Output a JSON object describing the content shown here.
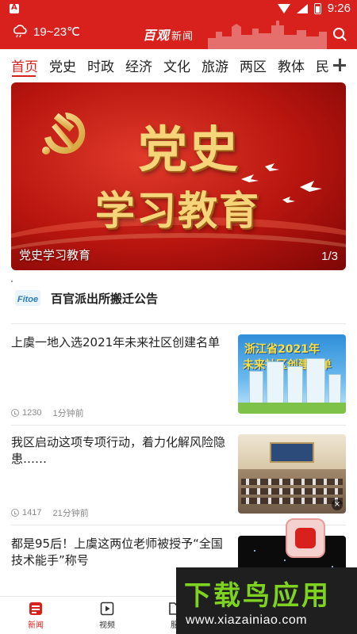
{
  "status_bar": {
    "time": "9:26"
  },
  "header": {
    "weather": "19~23℃",
    "brand": "百观",
    "brand_sub": "新闻"
  },
  "tabs": [
    "首页",
    "党史",
    "时政",
    "经济",
    "文化",
    "旅游",
    "两区",
    "教体",
    "民"
  ],
  "banner": {
    "title_line1": "党史",
    "title_line2": "学习教育",
    "caption": "党史学习教育",
    "counter": "1/3"
  },
  "notice": {
    "icon_text": "Fitoe",
    "text": "百官派出所搬迁公告"
  },
  "news": [
    {
      "title": "上虞一地入选2021年未来社区创建名单",
      "views": "1230",
      "time": "1分钟前",
      "thumb_line1": "浙江省2021年",
      "thumb_line2": "未来社区创建名单"
    },
    {
      "title": "我区启动这项专项行动，着力化解风险隐患……",
      "views": "1417",
      "time": "21分钟前"
    },
    {
      "title": "都是95后！上虞这两位老师被授予“全国技术能手”称号"
    }
  ],
  "bottom_nav": [
    {
      "label": "新闻",
      "icon": "news-icon"
    },
    {
      "label": "视频",
      "icon": "video-icon"
    },
    {
      "label": "服",
      "icon": "service-icon"
    }
  ],
  "watermark": {
    "title": "下载鸟应用",
    "url": "www.xiazainiao.com"
  },
  "colors": {
    "brand_red": "#d8211d",
    "watermark_green": "#7ed321"
  }
}
